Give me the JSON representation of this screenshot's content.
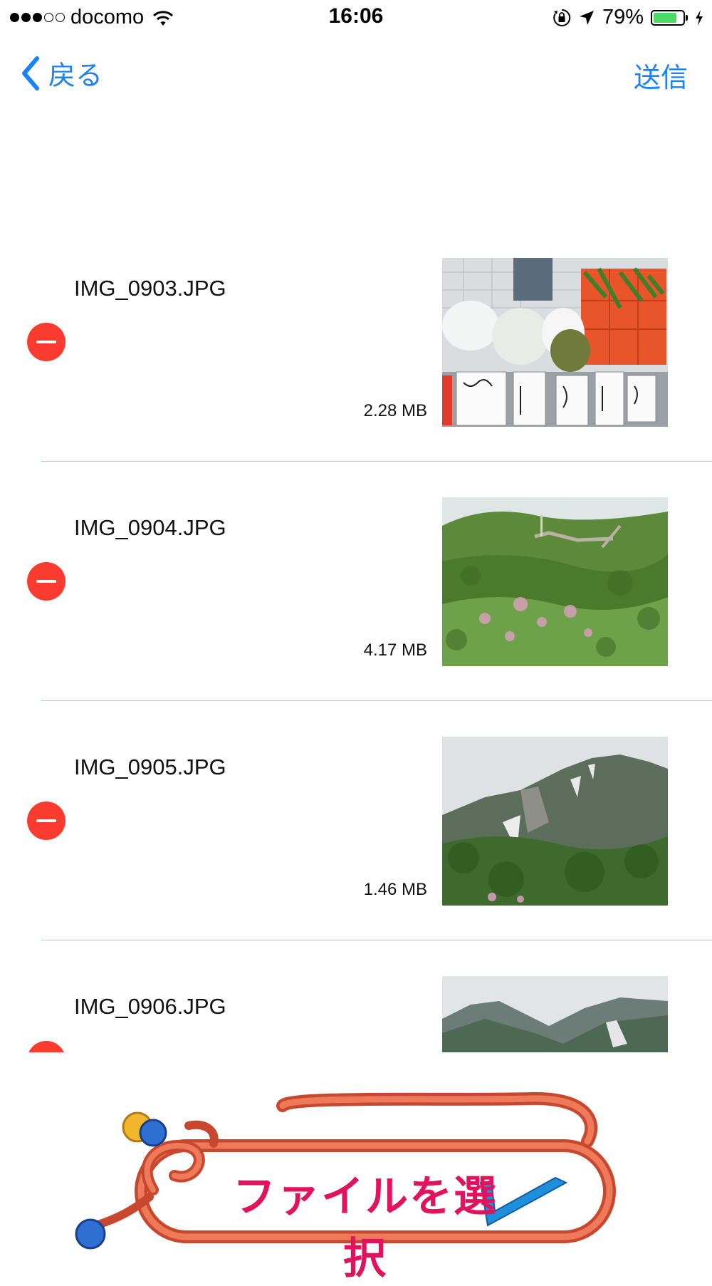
{
  "status_bar": {
    "carrier": "docomo",
    "time": "16:06",
    "battery_percent": "79%",
    "battery_level": 0.79,
    "signal_bars": 3,
    "signal_total": 5,
    "icons": [
      "wifi-icon",
      "orientation-lock-icon",
      "location-arrow-icon",
      "battery-icon",
      "charging-bolt-icon"
    ]
  },
  "nav": {
    "back_label": "戻る",
    "send_label": "送信"
  },
  "files": [
    {
      "name": "IMG_0903.JPG",
      "size": "2.28 MB",
      "thumbnail": "market-stall-photo"
    },
    {
      "name": "IMG_0904.JPG",
      "size": "4.17 MB",
      "thumbnail": "green-forest-mountain-photo"
    },
    {
      "name": "IMG_0905.JPG",
      "size": "1.46 MB",
      "thumbnail": "mountain-peak-snow-photo"
    },
    {
      "name": "IMG_0906.JPG",
      "size": "",
      "thumbnail": "mountain-range-photo"
    }
  ],
  "select_button": {
    "label": "ファイルを選択"
  },
  "colors": {
    "accent": "#1a82fb",
    "delete": "#fb3b30",
    "separator": "#7be0ea",
    "select_label": "#e0135c",
    "rope": "#e0664a"
  }
}
